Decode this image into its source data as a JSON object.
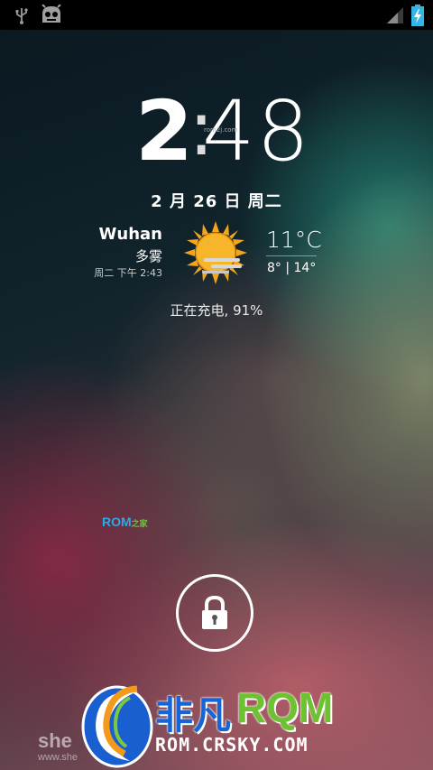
{
  "status_bar": {
    "left_icons": [
      "usb-icon",
      "cyanogen-android-icon"
    ],
    "right_icons": [
      "signal-icon",
      "battery-charging-icon"
    ],
    "battery_color": "#33b5e5"
  },
  "clock": {
    "hours": "2",
    "colon": ":",
    "minutes": "48",
    "watermark": "rom2j.com"
  },
  "date": "2 月 26 日 周二",
  "weather": {
    "city": "Wuhan",
    "condition": "多雾",
    "updated": "周二 下午 2:43",
    "icon": "sun-fog-icon",
    "temperature": "11°C",
    "range": "8° | 14°"
  },
  "charging_text": "正在充电, 91%",
  "rom_watermark": {
    "main": "ROM",
    "suffix": "之家"
  },
  "unlock": {
    "icon": "lock-icon"
  },
  "branding": {
    "she_text": "she",
    "www_text": "www.she",
    "logo_cn": "非凡",
    "logo_rom": "RQM",
    "url": "ROM.CRSKY.COM"
  }
}
